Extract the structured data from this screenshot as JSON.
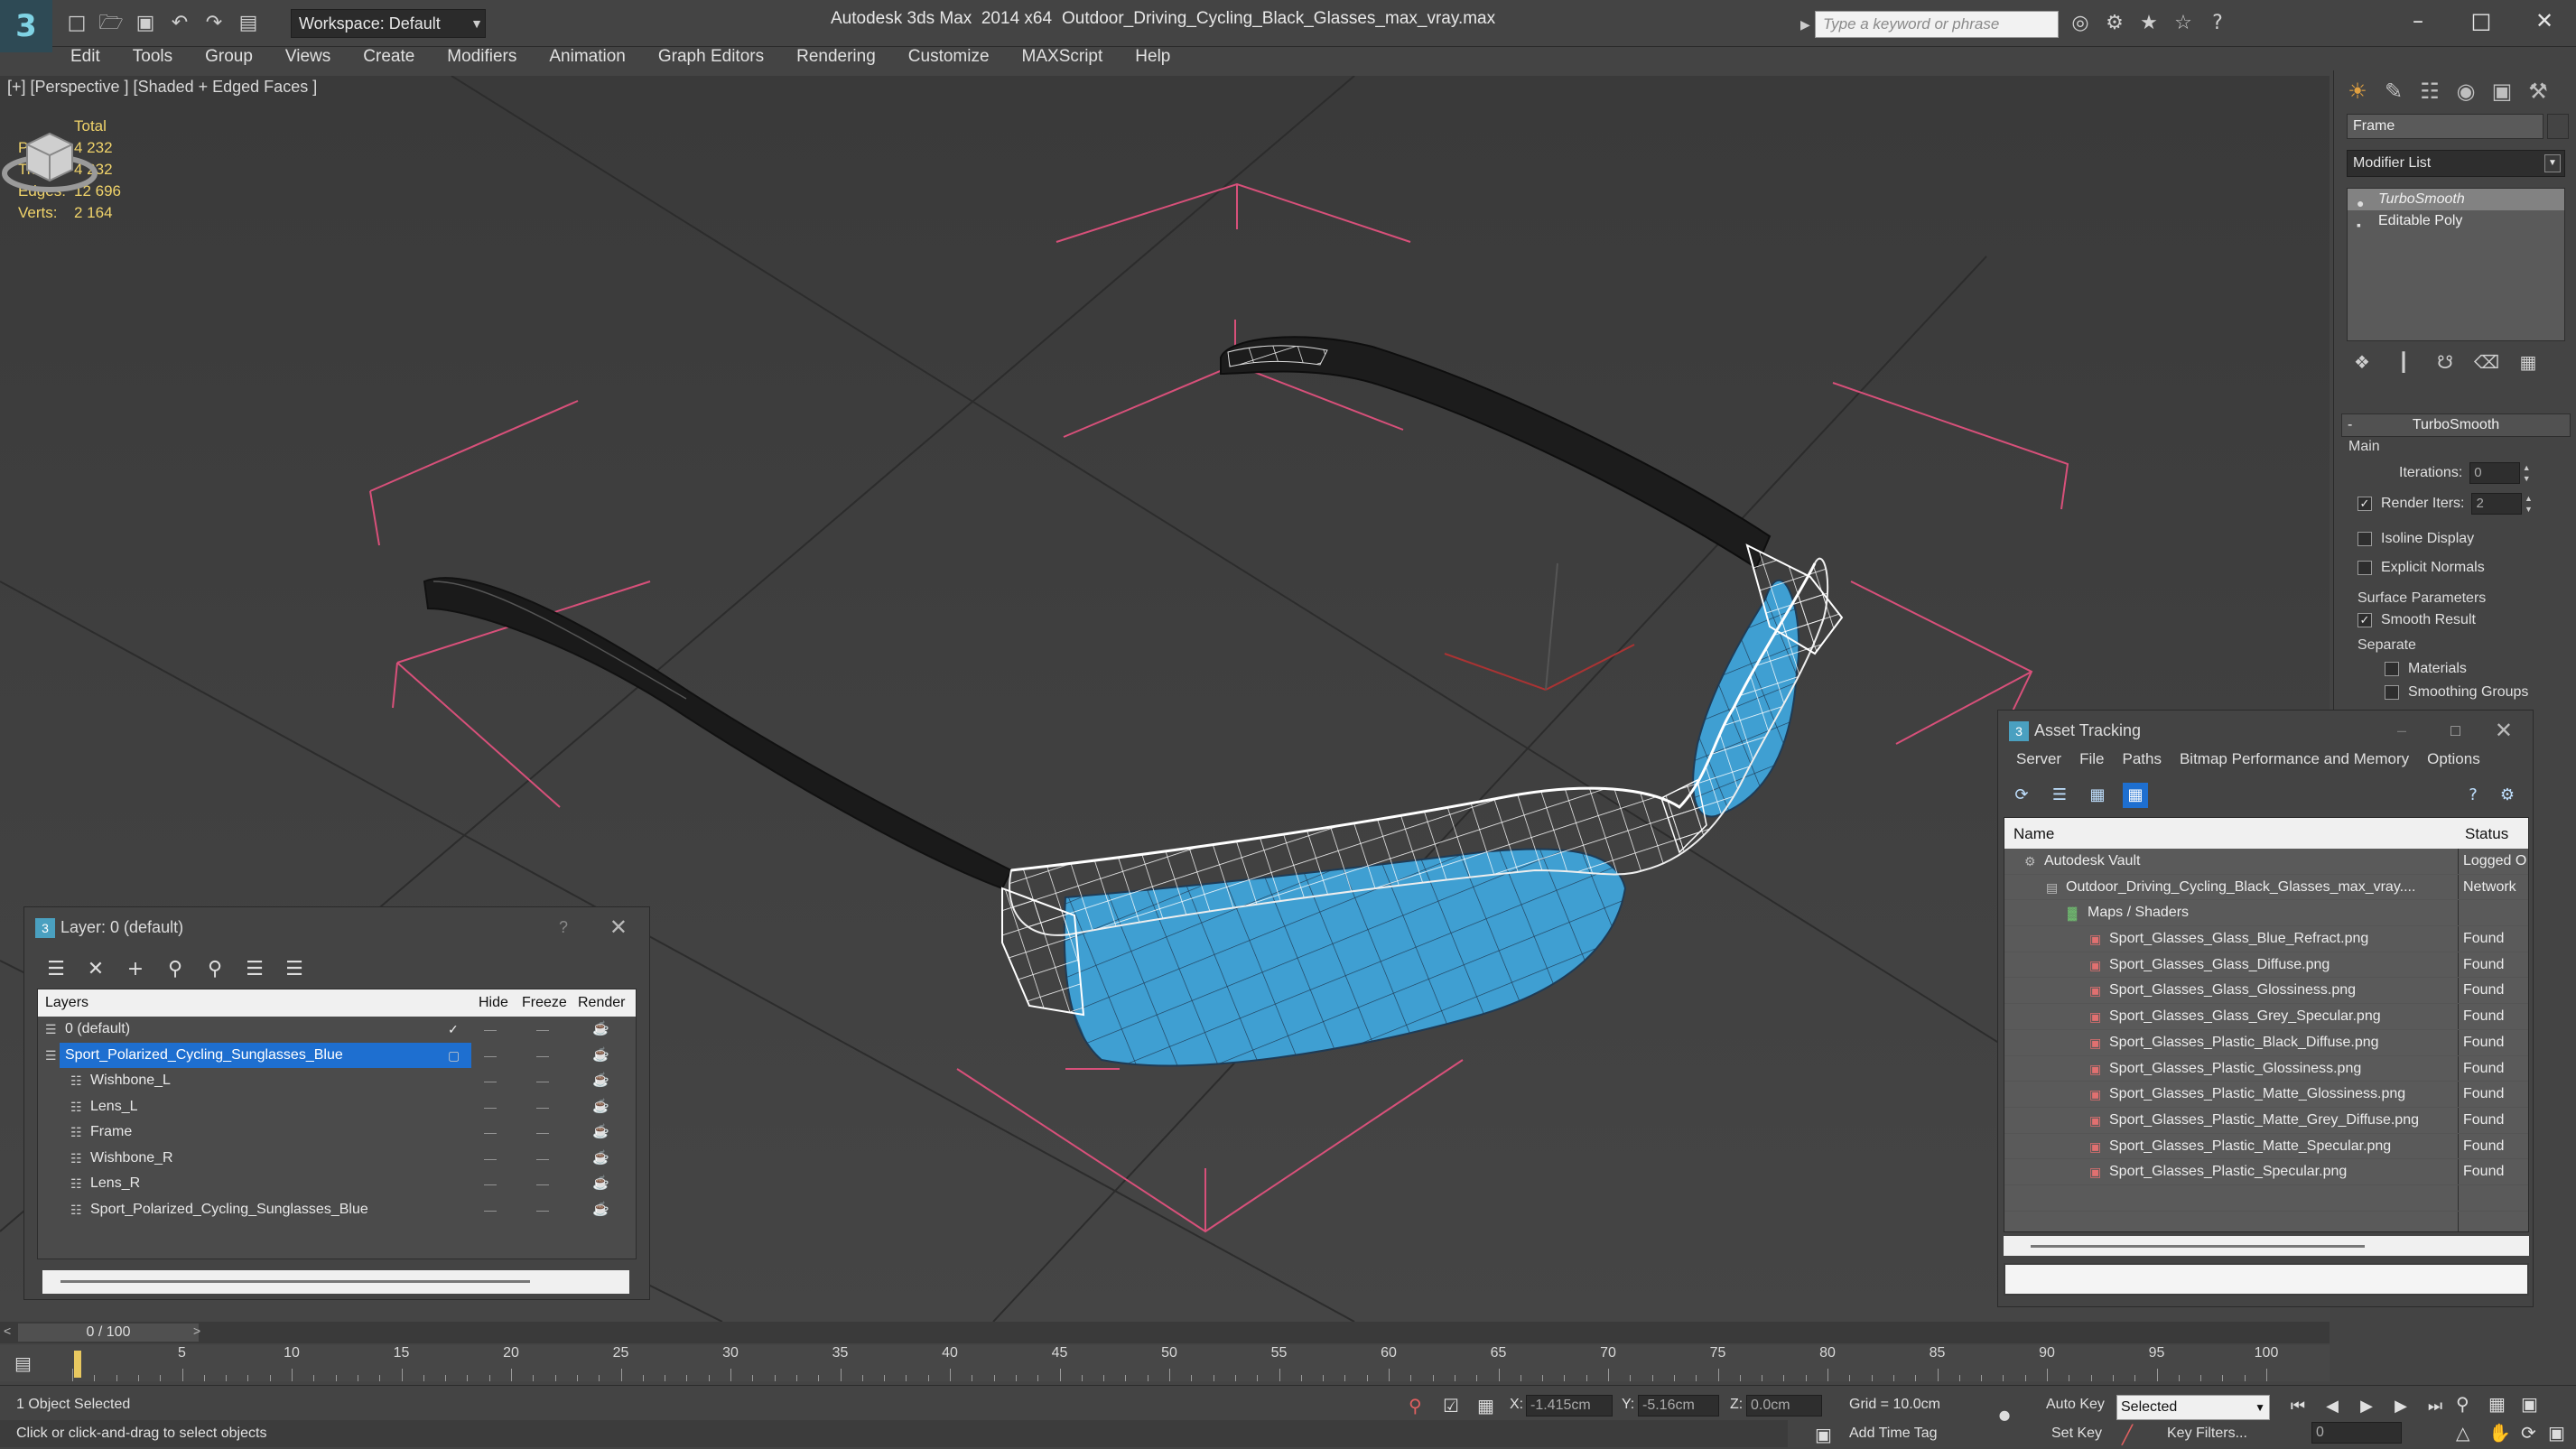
{
  "app": {
    "title": "Autodesk 3ds Max  2014 x64",
    "document": "Outdoor_Driving_Cycling_Black_Glasses_max_vray.max",
    "workspace": "Workspace: Default",
    "search_placeholder": "Type a keyword or phrase"
  },
  "menu": [
    "Edit",
    "Tools",
    "Group",
    "Views",
    "Create",
    "Modifiers",
    "Animation",
    "Graph Editors",
    "Rendering",
    "Customize",
    "MAXScript",
    "Help"
  ],
  "viewport": {
    "label": "[+] [Perspective ] [Shaded + Edged Faces ]",
    "stats": {
      "total_label": "Total",
      "rows": [
        {
          "k": "Polys:",
          "v": "4 232"
        },
        {
          "k": "Tris:",
          "v": "4 232"
        },
        {
          "k": "Edges:",
          "v": "12 696"
        },
        {
          "k": "Verts:",
          "v": "2 164"
        }
      ]
    }
  },
  "command_panel": {
    "object_name": "Frame",
    "modifier_list": "Modifier List",
    "stack": [
      "TurboSmooth",
      "Editable Poly"
    ],
    "rollout": "TurboSmooth",
    "main_group": "Main",
    "iterations_label": "Iterations:",
    "iterations_value": "0",
    "render_iters_label": "Render Iters:",
    "render_iters_value": "2",
    "isoline_label": "Isoline Display",
    "explicit_label": "Explicit Normals",
    "surface_group": "Surface Parameters",
    "smooth_label": "Smooth Result",
    "separate_group": "Separate",
    "materials_label": "Materials",
    "smoothing_label": "Smoothing Groups"
  },
  "layer_window": {
    "title": "Layer: 0 (default)",
    "help": "?",
    "columns": [
      "Layers",
      "Hide",
      "Freeze",
      "Render"
    ],
    "rows": [
      {
        "name": "0 (default)",
        "indent": 0
      },
      {
        "name": "Sport_Polarized_Cycling_Sunglasses_Blue",
        "indent": 0
      },
      {
        "name": "Wishbone_L",
        "indent": 1
      },
      {
        "name": "Lens_L",
        "indent": 1
      },
      {
        "name": "Frame",
        "indent": 1
      },
      {
        "name": "Wishbone_R",
        "indent": 1
      },
      {
        "name": "Lens_R",
        "indent": 1
      },
      {
        "name": "Sport_Polarized_Cycling_Sunglasses_Blue",
        "indent": 1
      }
    ]
  },
  "asset_tracking": {
    "title": "Asset Tracking",
    "menu": [
      "Server",
      "File",
      "Paths",
      "Bitmap Performance and Memory",
      "Options"
    ],
    "columns": [
      "Name",
      "Status"
    ],
    "rows": [
      {
        "name": "Autodesk Vault",
        "status": "Logged O",
        "level": 0
      },
      {
        "name": "Outdoor_Driving_Cycling_Black_Glasses_max_vray....",
        "status": "Network",
        "level": 1
      },
      {
        "name": "Maps / Shaders",
        "status": "",
        "level": 2
      },
      {
        "name": "Sport_Glasses_Glass_Blue_Refract.png",
        "status": "Found",
        "level": 3
      },
      {
        "name": "Sport_Glasses_Glass_Diffuse.png",
        "status": "Found",
        "level": 3
      },
      {
        "name": "Sport_Glasses_Glass_Glossiness.png",
        "status": "Found",
        "level": 3
      },
      {
        "name": "Sport_Glasses_Glass_Grey_Specular.png",
        "status": "Found",
        "level": 3
      },
      {
        "name": "Sport_Glasses_Plastic_Black_Diffuse.png",
        "status": "Found",
        "level": 3
      },
      {
        "name": "Sport_Glasses_Plastic_Glossiness.png",
        "status": "Found",
        "level": 3
      },
      {
        "name": "Sport_Glasses_Plastic_Matte_Glossiness.png",
        "status": "Found",
        "level": 3
      },
      {
        "name": "Sport_Glasses_Plastic_Matte_Grey_Diffuse.png",
        "status": "Found",
        "level": 3
      },
      {
        "name": "Sport_Glasses_Plastic_Matte_Specular.png",
        "status": "Found",
        "level": 3
      },
      {
        "name": "Sport_Glasses_Plastic_Specular.png",
        "status": "Found",
        "level": 3
      }
    ]
  },
  "timeline": {
    "frame": "0 / 100",
    "ticks": [
      "5",
      "10",
      "15",
      "20",
      "25",
      "30",
      "35",
      "40",
      "45",
      "50",
      "55",
      "60",
      "65",
      "70",
      "75",
      "80",
      "85",
      "90",
      "95",
      "100"
    ]
  },
  "status": {
    "selected": "1 Object Selected",
    "prompt": "Click or click-and-drag to select objects",
    "x_label": "X:",
    "x_value": "-1.415cm",
    "y_label": "Y:",
    "y_value": "-5.16cm",
    "z_label": "Z:",
    "z_value": "0.0cm",
    "grid": "Grid = 10.0cm",
    "auto_key": "Auto Key",
    "set_key": "Set Key",
    "selected_mode": "Selected",
    "key_filters": "Key Filters...",
    "add_time_tag": "Add Time Tag",
    "frame_value": "0"
  },
  "colors": {
    "lens": "#3f9fd2",
    "grid_box": "#d8507a",
    "stats_text": "#f0d36a",
    "selection": "#1e6fd0"
  }
}
